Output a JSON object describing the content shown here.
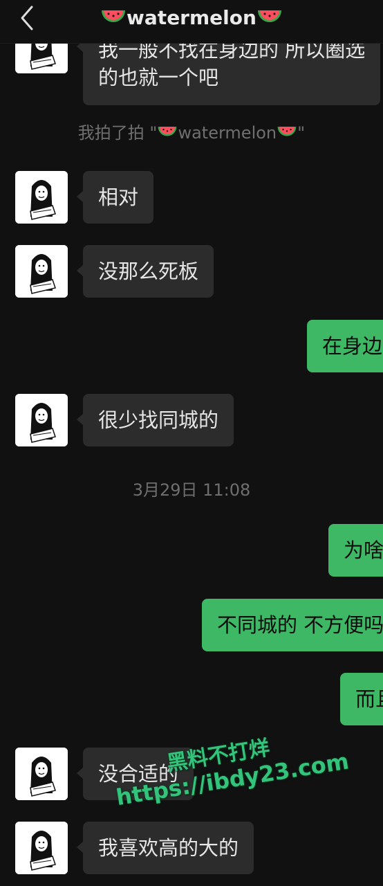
{
  "header": {
    "title": "watermelon",
    "back_icon": "chevron-left-icon",
    "title_emoji": "watermelon-icon"
  },
  "messages": [
    {
      "side": "in",
      "lines": [
        "我一般不找在身边的 所以圈选",
        "的也就一个吧"
      ]
    },
    {
      "type": "system",
      "text_prefix": "我拍了拍 \"",
      "text_name": "watermelon",
      "text_suffix": "\""
    },
    {
      "side": "in",
      "text": "相对"
    },
    {
      "side": "in",
      "text": "没那么死板"
    },
    {
      "side": "out",
      "text": "在身边"
    },
    {
      "side": "in",
      "text": "很少找同城的"
    },
    {
      "type": "time",
      "text": "3月29日 11:08"
    },
    {
      "side": "out",
      "text": "为啥"
    },
    {
      "side": "out",
      "text": "不同城的 不方便吗"
    },
    {
      "side": "out",
      "text": "而且"
    },
    {
      "side": "in",
      "text": "没合适的"
    },
    {
      "side": "in",
      "text": "我喜欢高的大的"
    }
  ],
  "watermark": {
    "line1": "黑料不打烊",
    "line2": "https://ibdy23.com"
  },
  "colors": {
    "background": "#111111",
    "incoming_bubble": "#2c2c2c",
    "outgoing_bubble": "#3eb865",
    "system_text": "#6f6f6f",
    "watermark": "#34c37a"
  }
}
